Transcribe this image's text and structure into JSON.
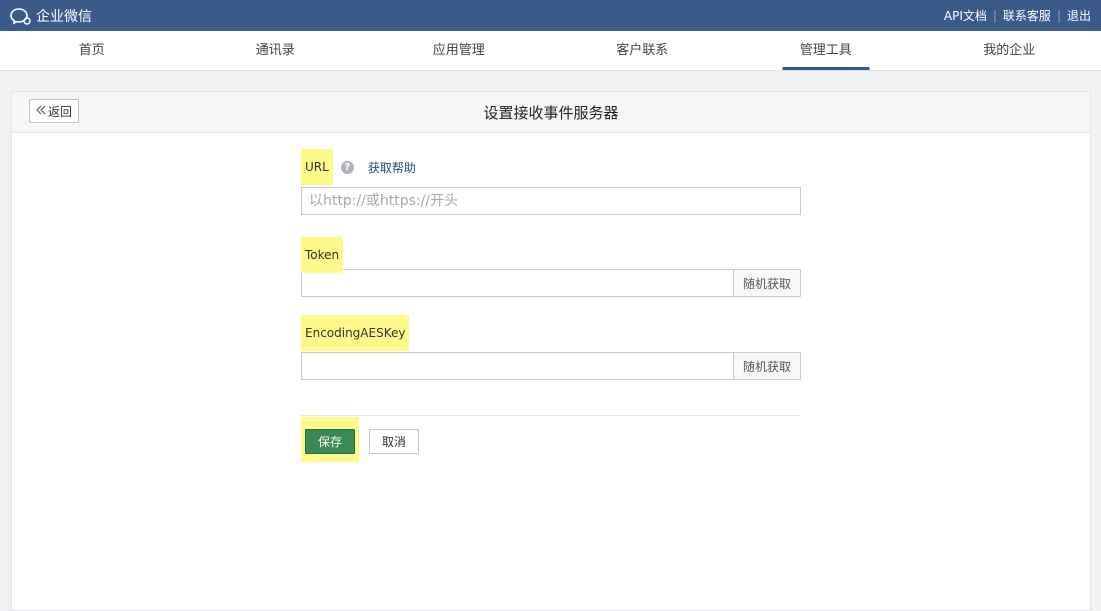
{
  "app": {
    "name": "企业微信"
  },
  "top_links": [
    "API文档",
    "联系客服",
    "退出"
  ],
  "nav": {
    "items": [
      "首页",
      "通讯录",
      "应用管理",
      "客户联系",
      "管理工具",
      "我的企业"
    ],
    "active_index": 4
  },
  "panel": {
    "back_label": "返回",
    "title": "设置接收事件服务器"
  },
  "form": {
    "url": {
      "label": "URL",
      "help_link": "获取帮助",
      "placeholder": "以http://或https://开头",
      "value": ""
    },
    "token": {
      "label": "Token",
      "value": "",
      "addon": "随机获取"
    },
    "aeskey": {
      "label": "EncodingAESKey",
      "value": "",
      "addon": "随机获取"
    },
    "save_label": "保存",
    "cancel_label": "取消"
  },
  "colors": {
    "header": "#3a5a8a",
    "highlight": "#fdf98a",
    "save": "#3a8a55"
  }
}
